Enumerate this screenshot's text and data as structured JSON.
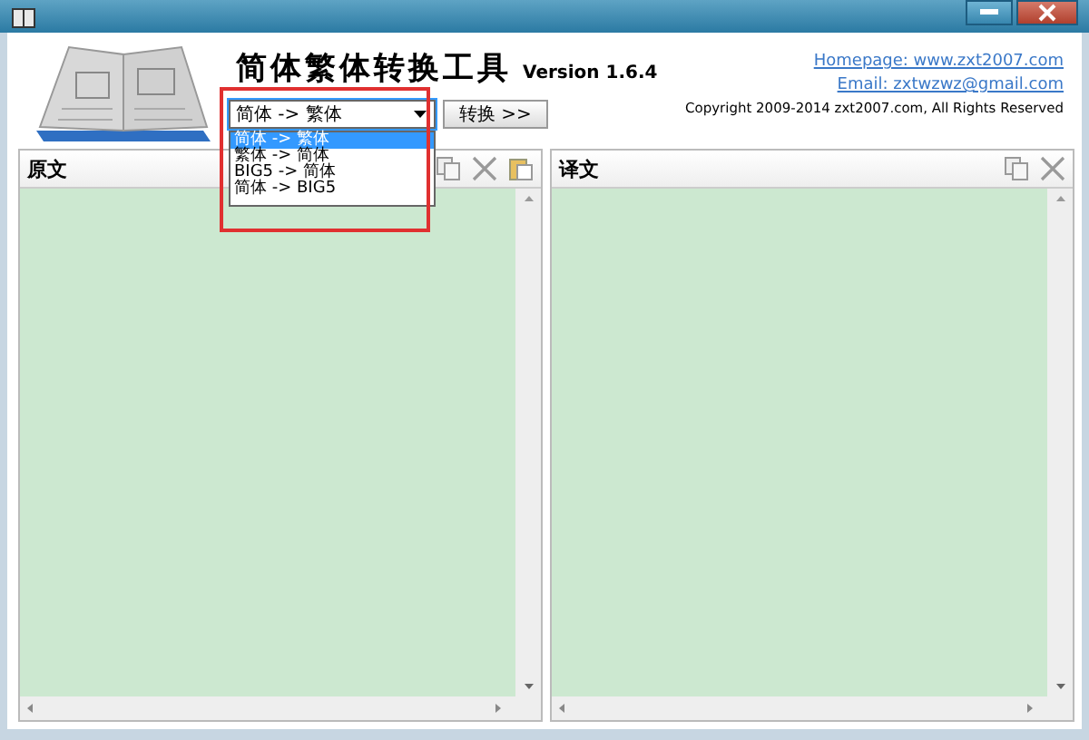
{
  "app": {
    "title": "简体繁体转换工具",
    "version": "Version 1.6.4"
  },
  "links": {
    "homepage": "Homepage: www.zxt2007.com",
    "email": "Email: zxtwzwz@gmail.com",
    "copyright": "Copyright 2009-2014 zxt2007.com, All Rights Reserved"
  },
  "mode_select": {
    "value": "简体 -> 繁体",
    "expanded": true,
    "options": [
      {
        "label": "简体 -> 繁体",
        "selected": true
      },
      {
        "label": "繁体 -> 简体",
        "selected": false
      },
      {
        "label": "BIG5 -> 简体",
        "selected": false
      },
      {
        "label": "简体 -> BIG5",
        "selected": false
      }
    ]
  },
  "convert_button": "转换 >>",
  "panels": [
    {
      "title": "原文",
      "tools": [
        {
          "kind": "copy"
        },
        {
          "kind": "cut"
        },
        {
          "kind": "paste"
        }
      ]
    },
    {
      "title": "译文",
      "tools": [
        {
          "kind": "copy"
        },
        {
          "kind": "cut"
        }
      ]
    }
  ]
}
